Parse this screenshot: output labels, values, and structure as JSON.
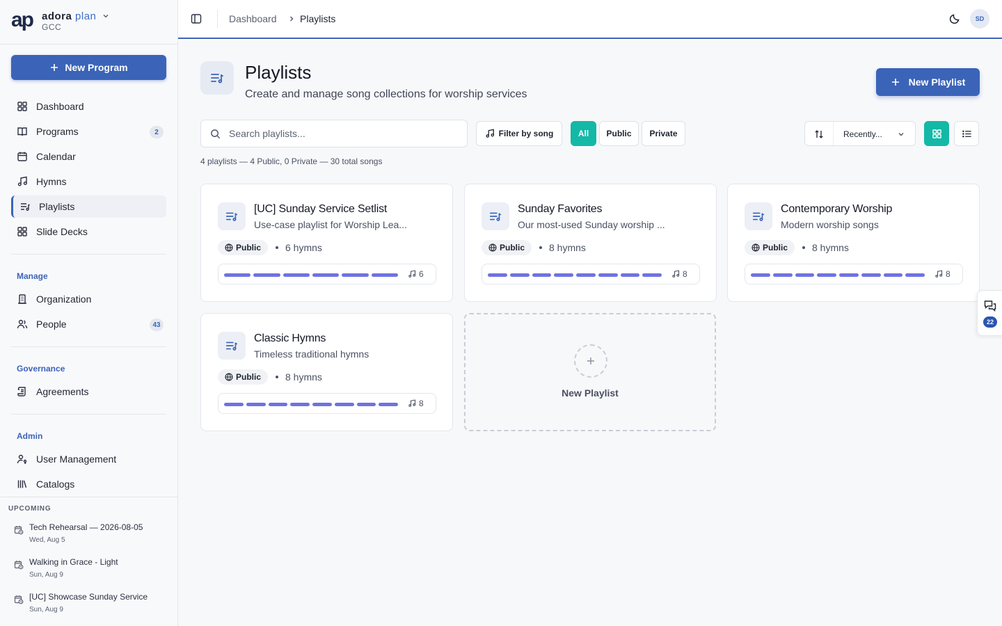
{
  "brand": {
    "logo_text": "ap",
    "name": "adora",
    "plan": "plan",
    "org": "GCC"
  },
  "sidebar": {
    "new_program_label": "New Program",
    "items": [
      {
        "label": "Dashboard",
        "icon": "grid-icon"
      },
      {
        "label": "Programs",
        "icon": "book-icon",
        "count": "2"
      },
      {
        "label": "Calendar",
        "icon": "calendar-icon"
      },
      {
        "label": "Hymns",
        "icon": "music-note-icon"
      },
      {
        "label": "Playlists",
        "icon": "playlist-icon",
        "active": true
      },
      {
        "label": "Slide Decks",
        "icon": "grid-icon"
      }
    ],
    "groups": {
      "manage": {
        "label": "Manage",
        "items": [
          {
            "label": "Organization",
            "icon": "building-icon"
          },
          {
            "label": "People",
            "icon": "users-icon",
            "count": "43"
          }
        ]
      },
      "governance": {
        "label": "Governance",
        "items": [
          {
            "label": "Agreements",
            "icon": "scroll-icon"
          }
        ]
      },
      "admin": {
        "label": "Admin",
        "items": [
          {
            "label": "User Management",
            "icon": "user-key-icon"
          },
          {
            "label": "Catalogs",
            "icon": "library-icon"
          }
        ]
      }
    },
    "upcoming": {
      "header": "UPCOMING",
      "items": [
        {
          "title": "Tech Rehearsal — 2026-08-05",
          "date": "Wed, Aug 5"
        },
        {
          "title": "Walking in Grace - Light",
          "date": "Sun, Aug 9"
        },
        {
          "title": "[UC] Showcase Sunday Service",
          "date": "Sun, Aug 9"
        }
      ]
    }
  },
  "topbar": {
    "breadcrumb": [
      "Dashboard",
      "Playlists"
    ],
    "avatar_initials": "SD"
  },
  "page": {
    "title": "Playlists",
    "subtitle": "Create and manage song collections for worship services",
    "new_playlist_label": "New Playlist",
    "search_placeholder": "Search playlists...",
    "filter_by_song_label": "Filter by song",
    "filters": [
      "All",
      "Public",
      "Private"
    ],
    "active_filter": "All",
    "sort_value": "Recently...",
    "view_mode": "grid",
    "summary": "4 playlists — 4 Public, 0 Private — 30 total songs"
  },
  "playlists": [
    {
      "title": "[UC] Sunday Service Setlist",
      "description": "Use-case playlist for Worship Lea...",
      "visibility": "Public",
      "hymns_label": "6 hymns",
      "count": "6",
      "segments": 6
    },
    {
      "title": "Sunday Favorites",
      "description": "Our most-used Sunday worship ...",
      "visibility": "Public",
      "hymns_label": "8 hymns",
      "count": "8",
      "segments": 8
    },
    {
      "title": "Contemporary Worship",
      "description": "Modern worship songs",
      "visibility": "Public",
      "hymns_label": "8 hymns",
      "count": "8",
      "segments": 8
    },
    {
      "title": "Classic Hymns",
      "description": "Timeless traditional hymns",
      "visibility": "Public",
      "hymns_label": "8 hymns",
      "count": "8",
      "segments": 8
    }
  ],
  "new_card_label": "New Playlist",
  "feedback_tab": {
    "count": "22"
  },
  "colors": {
    "primary": "#3b64b8",
    "accent_teal": "#14b8a6",
    "song_segment": "#6f72e0"
  }
}
